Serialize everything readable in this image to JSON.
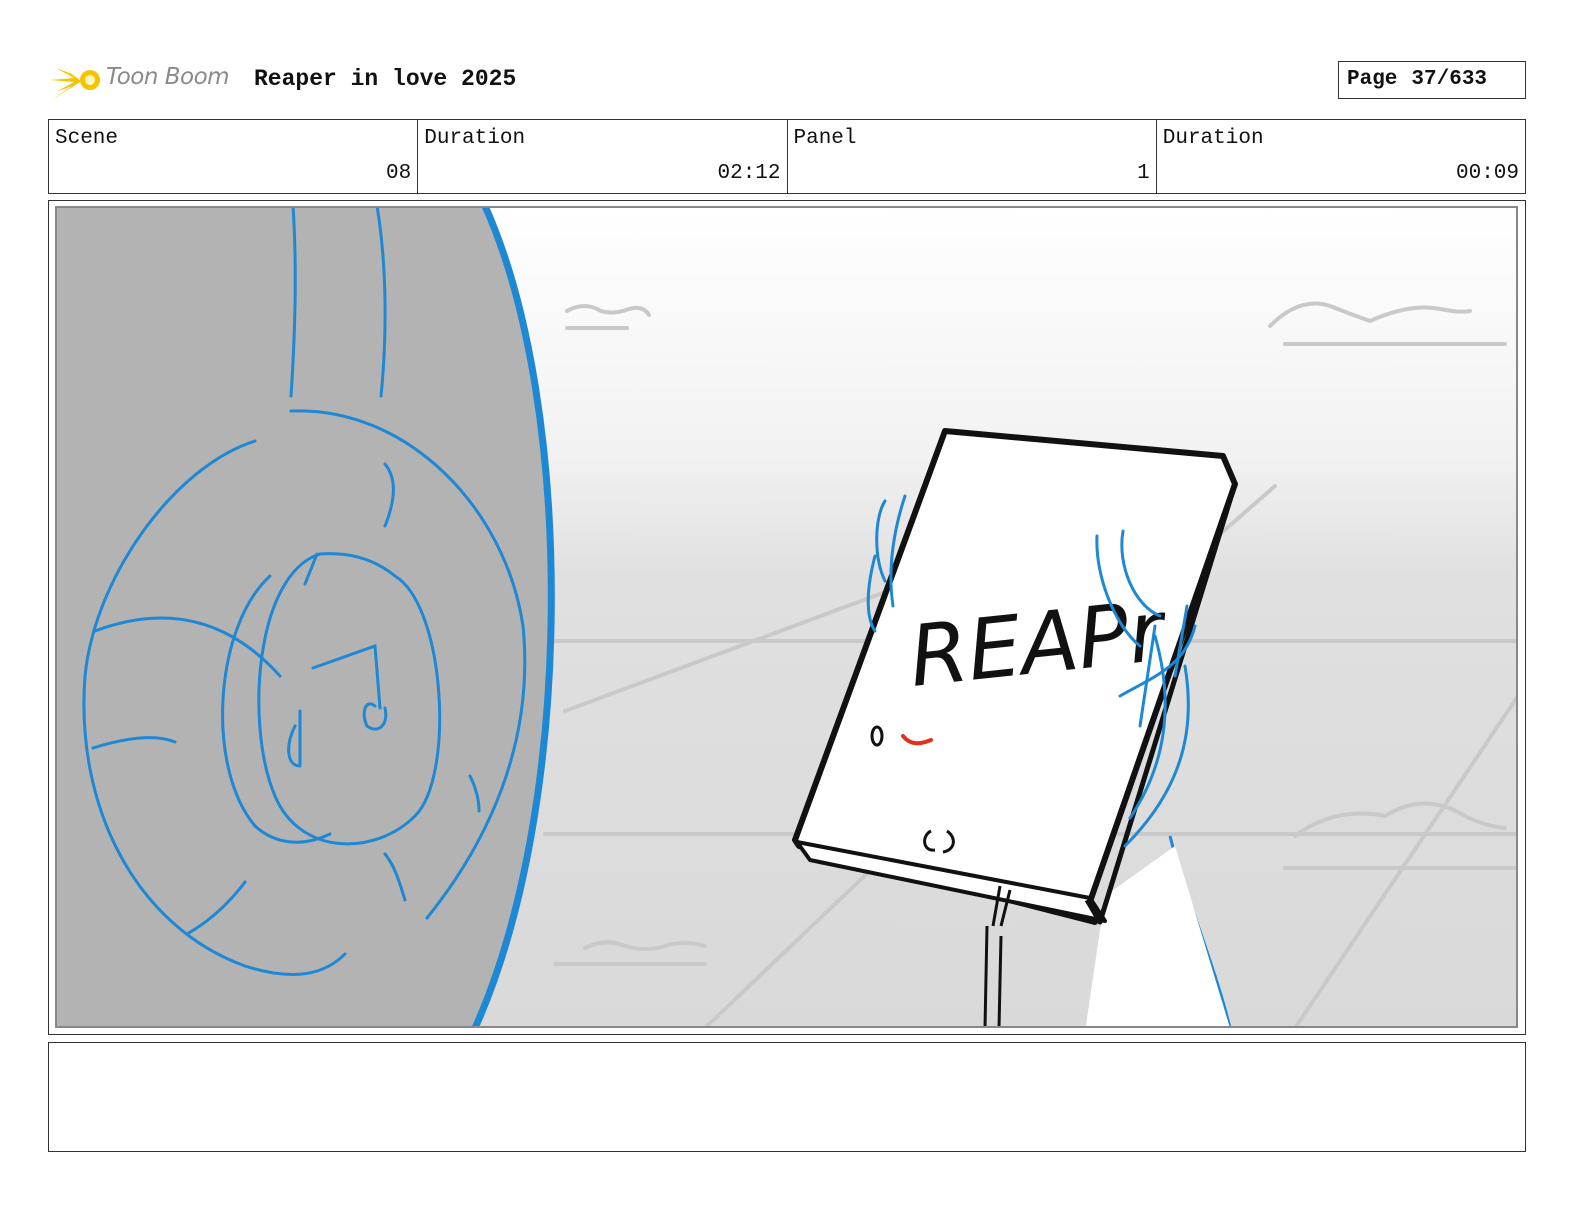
{
  "header": {
    "brand": "Toon Boom",
    "project_title": "Reaper in love 2025",
    "page_label": "Page",
    "page_number": "37/633"
  },
  "info": {
    "scene_label": "Scene",
    "scene_value": "08",
    "scene_duration_label": "Duration",
    "scene_duration_value": "02:12",
    "panel_label": "Panel",
    "panel_value": "1",
    "panel_duration_label": "Duration",
    "panel_duration_value": "00:09"
  },
  "panel": {
    "sign_text": "REAPr"
  },
  "notes": {
    "text": ""
  },
  "colors": {
    "sketch_blue": "#1e88d4",
    "left_fill": "#b3b3b3",
    "sky_top": "#ffffff",
    "sky_bottom": "#dcdcdc"
  }
}
